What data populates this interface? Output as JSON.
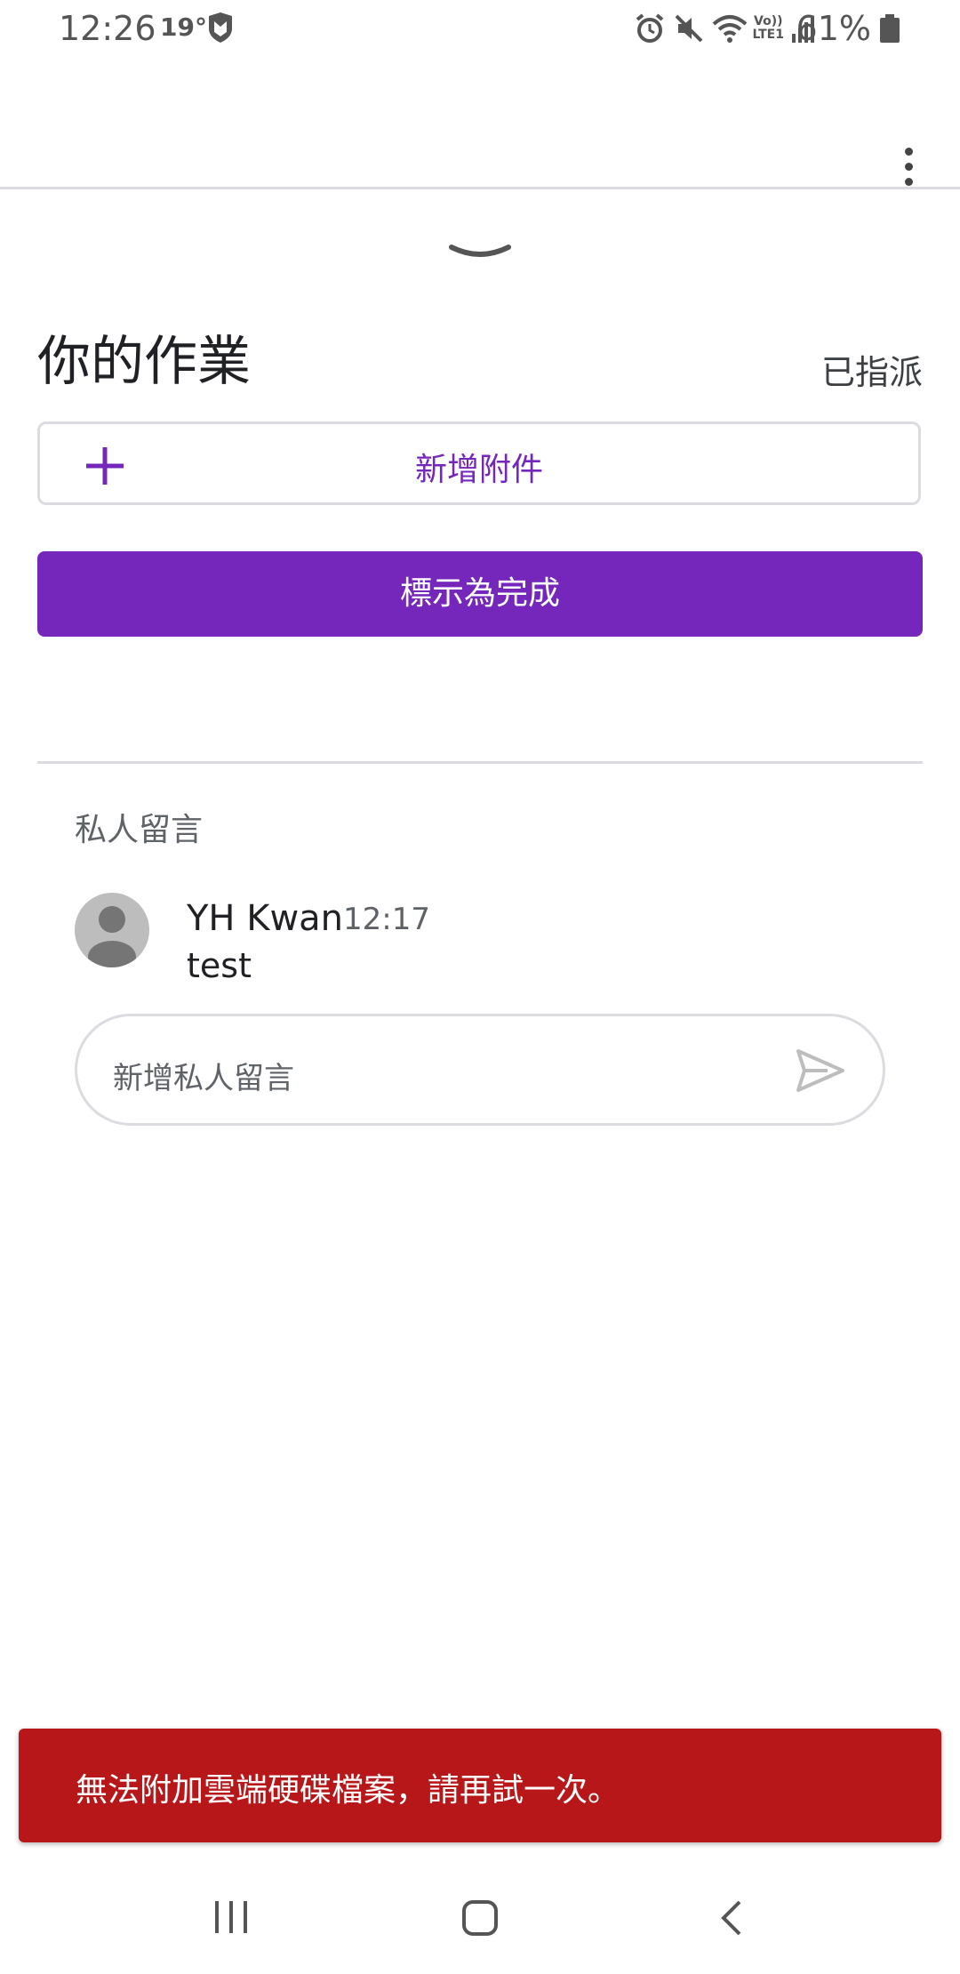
{
  "status_bar": {
    "time": "12:26",
    "temperature": "19°",
    "battery": "61%",
    "volte_top": "Vo))",
    "volte_bottom": "LTE1"
  },
  "assignment": {
    "title": "你的作業",
    "status": "已指派",
    "add_attachment_label": "新增附件",
    "mark_done_label": "標示為完成"
  },
  "private_comments": {
    "title": "私人留言",
    "comments": [
      {
        "author": "YH Kwan",
        "time": "12:17",
        "text": "test"
      }
    ],
    "input_placeholder": "新增私人留言"
  },
  "snackbar": {
    "message": "無法附加雲端硬碟檔案，請再試一次。"
  },
  "colors": {
    "accent": "#7627bb",
    "error": "#b71718"
  },
  "icons": [
    "more-vert-icon",
    "chevron-down-icon",
    "plus-icon",
    "send-icon",
    "avatar-icon"
  ]
}
